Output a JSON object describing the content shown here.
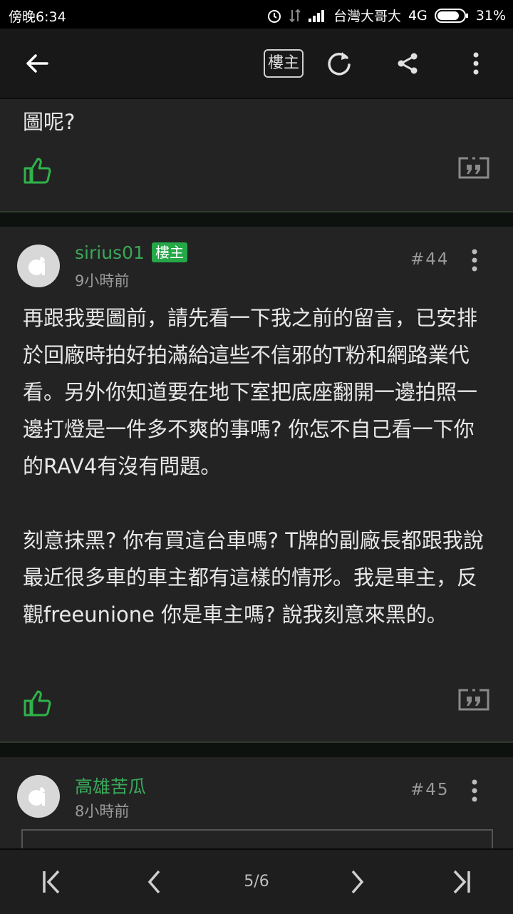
{
  "status_bar": {
    "time": "傍晚6:34",
    "carrier": "台灣大哥大",
    "network": "4G",
    "battery": "31%"
  },
  "toolbar": {
    "louzhu_filter": "樓主"
  },
  "previous_post": {
    "body_tail": "圖呢?"
  },
  "posts": [
    {
      "username": "sirius01",
      "badge": "樓主",
      "time": "9小時前",
      "floor": "#44",
      "body": "再跟我要圖前，請先看一下我之前的留言，已安排於回廠時拍好拍滿給這些不信邪的T粉和網路業代看。另外你知道要在地下室把底座翻開一邊拍照一邊打燈是一件多不爽的事嗎? 你怎不自己看一下你的RAV4有沒有問題。\n\n刻意抹黑? 你有買這台車嗎? T牌的副廠長都跟我說最近很多車的車主都有這樣的情形。我是車主，反觀freeunione 你是車主嗎? 說我刻意來黑的。"
    },
    {
      "username": "高雄苦瓜",
      "time": "8小時前",
      "floor": "#45"
    }
  ],
  "pagination": {
    "indicator": "5/6"
  },
  "icons": {
    "back": "arrow-left-icon",
    "refresh": "refresh-icon",
    "share": "share-icon",
    "more": "more-vertical-icon",
    "like": "thumbs-up-icon",
    "quote": "quote-icon",
    "first": "first-page-icon",
    "prev": "chevron-left-icon",
    "next": "chevron-right-icon",
    "last": "last-page-icon"
  },
  "colors": {
    "accent_green": "#3aa75a",
    "badge_green": "#24a848",
    "card_bg": "#232323",
    "toolbar_bg": "#181818"
  }
}
